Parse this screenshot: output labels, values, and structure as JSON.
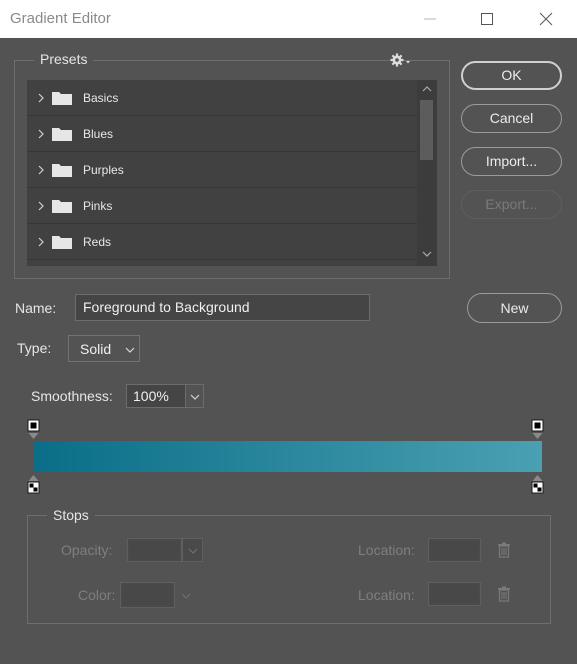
{
  "window": {
    "title": "Gradient Editor"
  },
  "presets": {
    "label": "Presets",
    "folders": [
      "Basics",
      "Blues",
      "Purples",
      "Pinks",
      "Reds"
    ]
  },
  "buttons": {
    "ok": "OK",
    "cancel": "Cancel",
    "import": "Import...",
    "export": "Export...",
    "new": "New"
  },
  "name": {
    "label": "Name:",
    "value": "Foreground to Background"
  },
  "type": {
    "label": "Type:",
    "value": "Solid"
  },
  "smoothness": {
    "label": "Smoothness:",
    "value": "100%"
  },
  "gradient": {
    "start_color": "#0a6e88",
    "end_color": "#4aa0b2"
  },
  "stops": {
    "label": "Stops",
    "opacity_label": "Opacity:",
    "color_label": "Color:",
    "location_label_1": "Location:",
    "location_label_2": "Location:"
  },
  "colors": {
    "background": "#535353",
    "list_background": "#414141",
    "titlebar": "#ffffff"
  }
}
